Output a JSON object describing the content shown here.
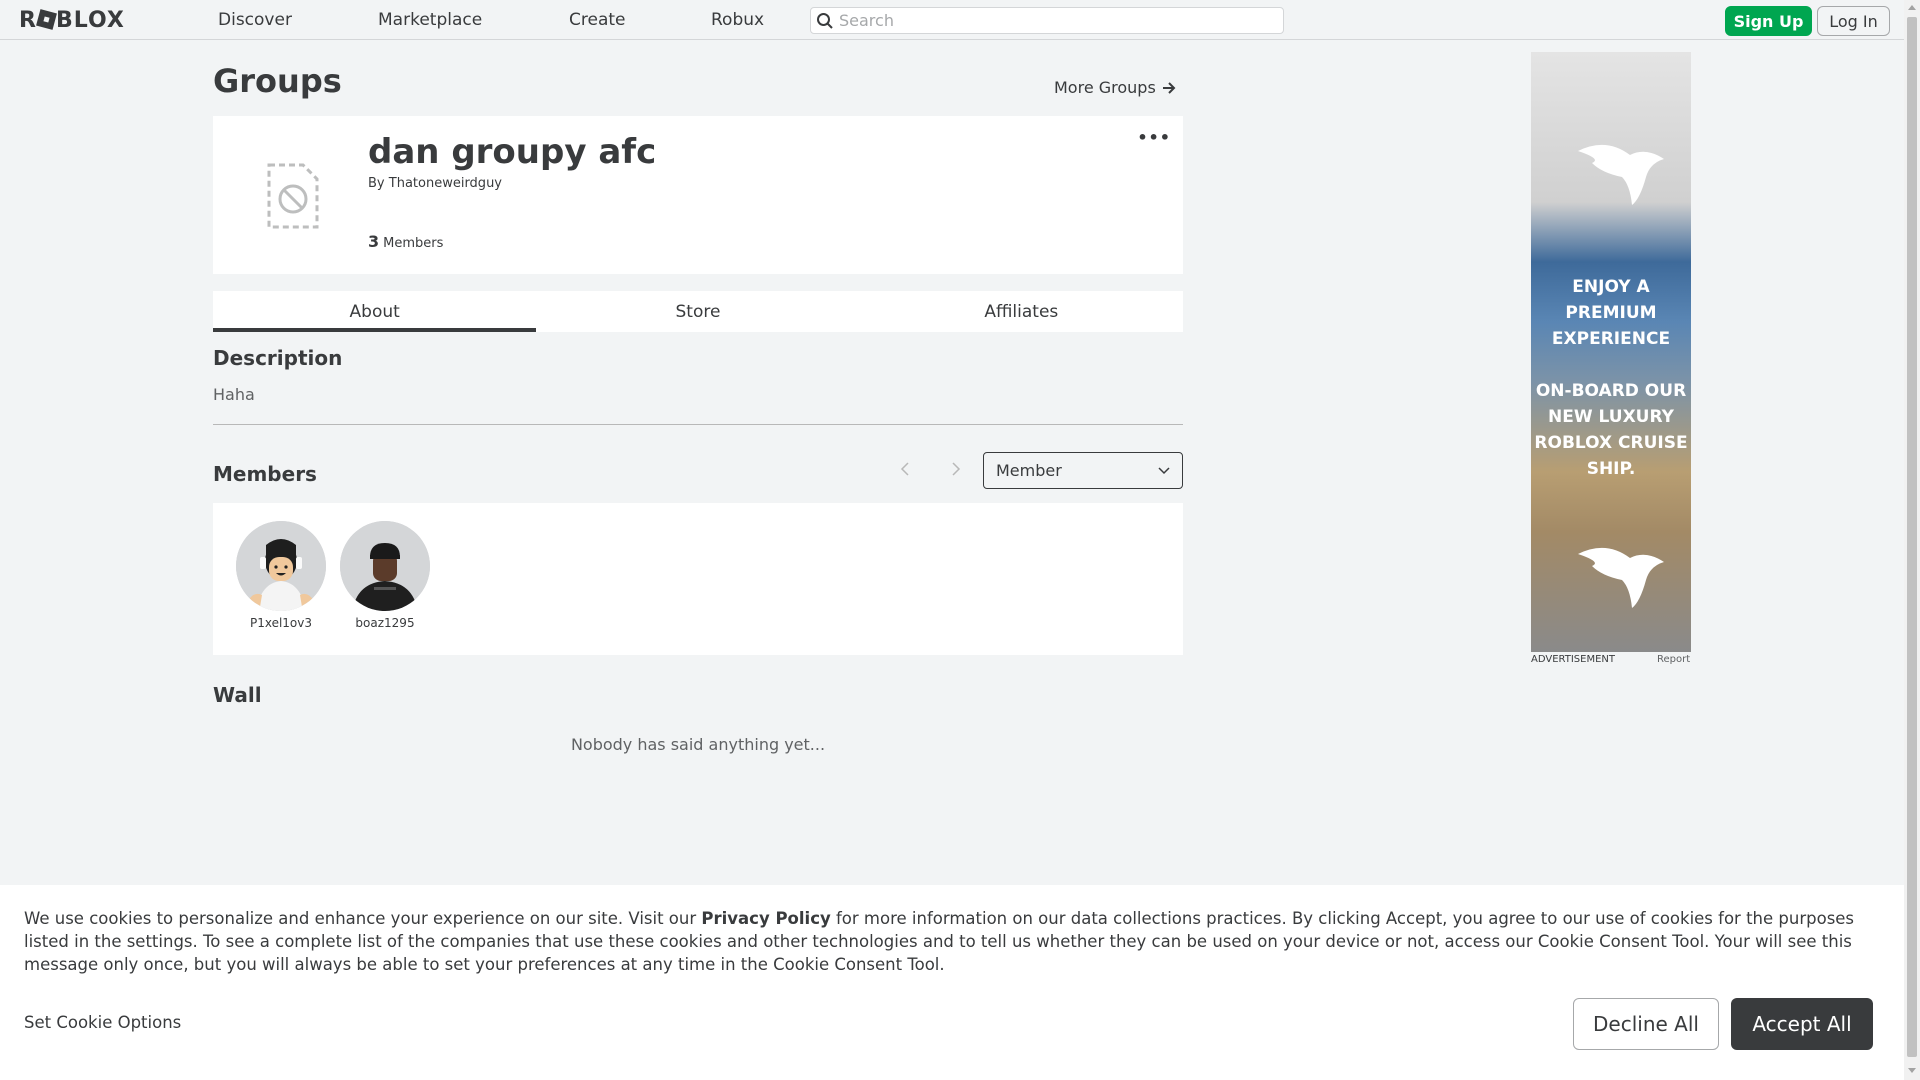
{
  "nav": {
    "logo": "ROBLOX",
    "links": [
      "Discover",
      "Marketplace",
      "Create",
      "Robux"
    ],
    "search_placeholder": "Search",
    "signup_label": "Sign Up",
    "login_label": "Log In"
  },
  "page": {
    "title": "Groups",
    "more_groups": "More Groups"
  },
  "group": {
    "name": "dan groupy afc",
    "by_prefix": "By",
    "owner": "Thatoneweirdguy",
    "member_count": "3",
    "member_count_label": "Members",
    "menu_icon": "ellipsis-icon"
  },
  "tabs": [
    {
      "label": "About",
      "active": true
    },
    {
      "label": "Store",
      "active": false
    },
    {
      "label": "Affiliates",
      "active": false
    }
  ],
  "description": {
    "title": "Description",
    "text": "Haha"
  },
  "members": {
    "title": "Members",
    "role_selected": "Member",
    "list": [
      {
        "name": "P1xel1ov3"
      },
      {
        "name": "boaz1295"
      }
    ]
  },
  "wall": {
    "title": "Wall",
    "empty_text": "Nobody has said anything yet..."
  },
  "ad": {
    "headline": [
      "ENJOY A",
      "PREMIUM",
      "EXPERIENCE"
    ],
    "body": [
      "ON-BOARD OUR",
      "NEW LUXURY",
      "ROBLOX CRUISE",
      "SHIP."
    ],
    "label": "ADVERTISEMENT",
    "report": "Report"
  },
  "cookie": {
    "text_before": "We use cookies to personalize and enhance your experience on our site. Visit our ",
    "privacy_link": "Privacy Policy",
    "text_after": " for more information on our data collections practices. By clicking Accept, you agree to our use of cookies for the purposes listed in the settings. To see a complete list of the companies that use these cookies and other technologies and to tell us whether they can be used on your device or not, access our Cookie Consent Tool. Your will see this message only once, but you will always be able to set your preferences at any time in the Cookie Consent Tool.",
    "options_label": "Set Cookie Options",
    "decline_label": "Decline All",
    "accept_label": "Accept All"
  },
  "colors": {
    "accent_green": "#00a650",
    "text_dark": "#393b3d",
    "page_bg": "#f2f4f5"
  }
}
